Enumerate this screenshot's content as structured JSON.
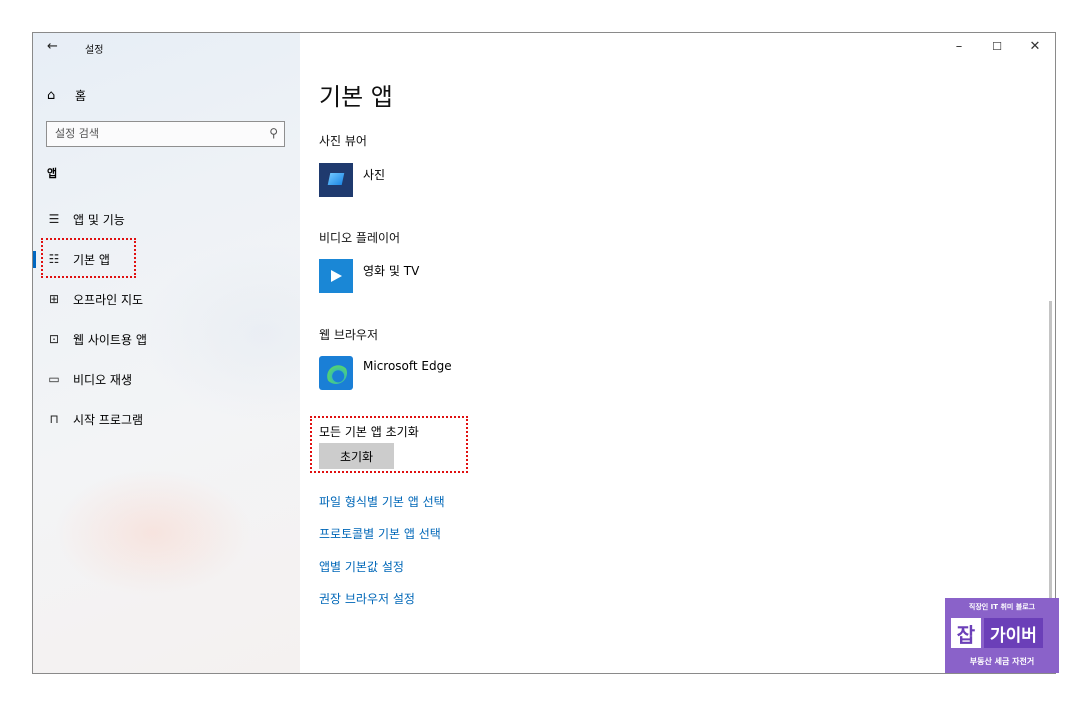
{
  "window": {
    "title": "설정",
    "minimize": "–",
    "maximize": "☐",
    "close": "✕"
  },
  "sidebar": {
    "home_label": "홈",
    "search_placeholder": "설정 검색",
    "section": "앱",
    "items": [
      {
        "label": "앱 및 기능",
        "icon": "apps-features-icon",
        "glyph": "☰",
        "active": false
      },
      {
        "label": "기본 앱",
        "icon": "default-apps-icon",
        "glyph": "☷",
        "active": true
      },
      {
        "label": "오프라인 지도",
        "icon": "offline-maps-icon",
        "glyph": "⊞",
        "active": false
      },
      {
        "label": "웹 사이트용 앱",
        "icon": "apps-for-websites-icon",
        "glyph": "⊡",
        "active": false
      },
      {
        "label": "비디오 재생",
        "icon": "video-playback-icon",
        "glyph": "▭",
        "active": false
      },
      {
        "label": "시작 프로그램",
        "icon": "startup-icon",
        "glyph": "⊓",
        "active": false
      }
    ]
  },
  "main": {
    "title": "기본 앱",
    "categories": [
      {
        "label": "사진 뷰어",
        "app": "사진",
        "icon": "photos-app-icon"
      },
      {
        "label": "비디오 플레이어",
        "app": "영화 및 TV",
        "icon": "movies-tv-app-icon"
      },
      {
        "label": "웹 브라우저",
        "app": "Microsoft Edge",
        "icon": "edge-app-icon"
      }
    ],
    "reset_label": "모든 기본 앱 초기화",
    "reset_button": "초기화",
    "links": [
      "파일 형식별 기본 앱 선택",
      "프로토콜별 기본 앱 선택",
      "앱별 기본값 설정",
      "권장 브라우저 설정"
    ]
  },
  "watermark": {
    "top": "직장인 IT 취미 블로그",
    "logo": "잡",
    "name": "가이버",
    "bottom": "부동산 세금 자전거"
  },
  "colors": {
    "accent": "#0067c0",
    "link": "#0067b8",
    "highlight": "#e01010",
    "watermark": "#8a62c9"
  }
}
